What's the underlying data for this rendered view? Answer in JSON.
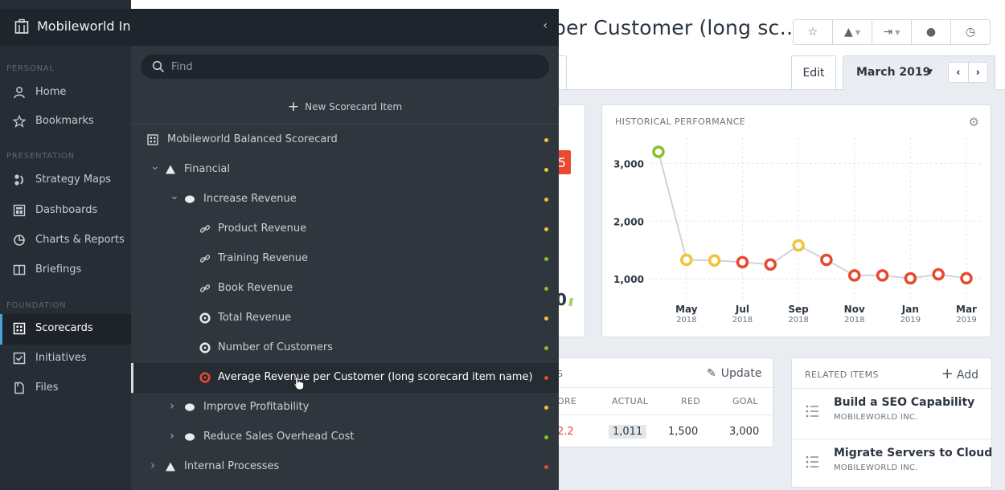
{
  "colors": {
    "red": "#e8492f",
    "yellow": "#f0c43a",
    "green": "#8bbf2a",
    "accent": "#4aa3df"
  },
  "sidebar": {
    "org_name": "Mobileworld Inc.",
    "sections": {
      "personal": "PERSONAL",
      "presentation": "PRESENTATION",
      "foundation": "FOUNDATION"
    },
    "items": [
      {
        "label": "Home",
        "icon": "user-icon"
      },
      {
        "label": "Bookmarks",
        "icon": "star-icon"
      },
      {
        "label": "Strategy Maps",
        "icon": "strategy-map-icon"
      },
      {
        "label": "Dashboards",
        "icon": "dashboard-icon"
      },
      {
        "label": "Charts & Reports",
        "icon": "pie-chart-icon"
      },
      {
        "label": "Briefings",
        "icon": "book-icon"
      },
      {
        "label": "Scorecards",
        "icon": "scorecard-icon",
        "active": true
      },
      {
        "label": "Initiatives",
        "icon": "checkbox-icon"
      },
      {
        "label": "Files",
        "icon": "file-icon"
      }
    ]
  },
  "panel": {
    "find_placeholder": "Find",
    "new_item_label": "New Scorecard Item",
    "tree": [
      {
        "label": "Mobileworld Balanced Scorecard",
        "kind": "scorecard",
        "status": "yellow"
      },
      {
        "label": "Financial",
        "kind": "perspective",
        "expanded": true,
        "status": "yellow"
      },
      {
        "label": "Increase Revenue",
        "kind": "objective",
        "expanded": true,
        "status": "yellow"
      },
      {
        "label": "Product Revenue",
        "kind": "link",
        "status": "yellow"
      },
      {
        "label": "Training Revenue",
        "kind": "link",
        "status": "green"
      },
      {
        "label": "Book Revenue",
        "kind": "link",
        "status": "green"
      },
      {
        "label": "Total Revenue",
        "kind": "kpi",
        "status": "yellow"
      },
      {
        "label": "Number of Customers",
        "kind": "kpi",
        "status": "green"
      },
      {
        "label": "Average Revenue per Customer (long scorecard item name)",
        "kind": "kpi",
        "status": "red",
        "selected": true
      },
      {
        "label": "Improve Profitability",
        "kind": "objective",
        "expanded": false,
        "status": "yellow"
      },
      {
        "label": "Reduce Sales Overhead Cost",
        "kind": "objective",
        "expanded": false,
        "status": "green"
      },
      {
        "label": "Internal Processes",
        "kind": "perspective",
        "expanded": false,
        "status": "red"
      }
    ]
  },
  "header": {
    "title": "per Customer (long sc…",
    "edit_label": "Edit",
    "period_label": "March 2019",
    "toolbar_icons": [
      "star-icon",
      "alert-icon",
      "share-icon",
      "info-icon",
      "clock-icon"
    ]
  },
  "score_card": {
    "score_fragment": "5",
    "gauge_value_fragment": "0"
  },
  "historical": {
    "title": "HISTORICAL PERFORMANCE"
  },
  "chart_data": {
    "type": "line",
    "title": "HISTORICAL PERFORMANCE",
    "x": [
      "Apr 2018",
      "May 2018",
      "Jun 2018",
      "Jul 2018",
      "Aug 2018",
      "Sep 2018",
      "Oct 2018",
      "Nov 2018",
      "Dec 2018",
      "Jan 2019",
      "Feb 2019",
      "Mar 2019"
    ],
    "values": [
      3200,
      1330,
      1320,
      1290,
      1250,
      1580,
      1330,
      1060,
      1060,
      1010,
      1080,
      1011
    ],
    "point_status": [
      "green",
      "yellow",
      "yellow",
      "red",
      "red",
      "yellow",
      "red",
      "red",
      "red",
      "red",
      "red",
      "red"
    ],
    "x_tick_labels": [
      {
        "month": "May",
        "year": "2018"
      },
      {
        "month": "Jul",
        "year": "2018"
      },
      {
        "month": "Sep",
        "year": "2018"
      },
      {
        "month": "Nov",
        "year": "2018"
      },
      {
        "month": "Jan",
        "year": "2019"
      },
      {
        "month": "Mar",
        "year": "2019"
      }
    ],
    "y_ticks": [
      {
        "value": 3000,
        "label": "3,000"
      },
      {
        "value": 2000,
        "label": "2,000"
      },
      {
        "value": 1000,
        "label": "1,000"
      }
    ],
    "ylim": [
      600,
      3450
    ],
    "grid": true,
    "legend": "none"
  },
  "measures": {
    "title_fragment": "S",
    "update_label": "Update",
    "columns": {
      "score": "ORE",
      "actual": "ACTUAL",
      "red": "RED",
      "goal": "GOAL"
    },
    "row": {
      "score": "2.2",
      "actual": "1,011",
      "red": "1,500",
      "goal": "3,000"
    }
  },
  "related": {
    "title": "RELATED ITEMS",
    "add_label": "Add",
    "items": [
      {
        "name": "Build a SEO Capability",
        "org": "MOBILEWORLD INC."
      },
      {
        "name": "Migrate Servers to Cloud",
        "org": "MOBILEWORLD INC."
      }
    ]
  }
}
